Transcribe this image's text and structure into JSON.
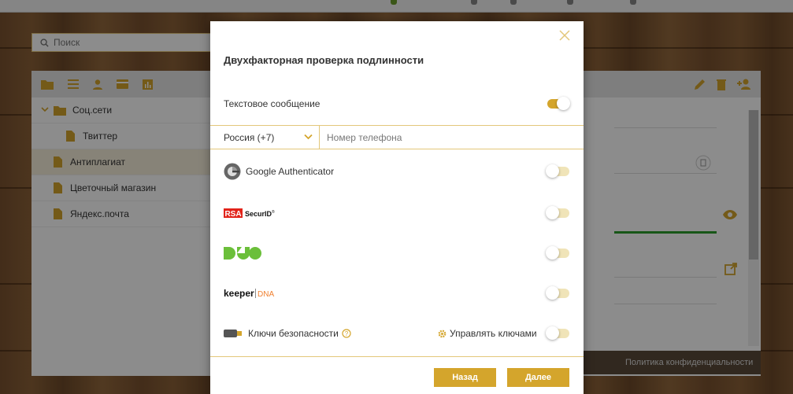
{
  "search": {
    "placeholder": "Поиск"
  },
  "tree": {
    "items": [
      {
        "label": "Соц.сети"
      },
      {
        "label": "Твиттер"
      },
      {
        "label": "Антиплагиат"
      },
      {
        "label": "Цветочный магазин"
      },
      {
        "label": "Яндекс.почта"
      }
    ]
  },
  "footer": {
    "privacy": "Политика конфиденциальности"
  },
  "modal": {
    "title": "Двухфакторная проверка подлинности",
    "sms": {
      "label": "Текстовое сообщение",
      "enabled": true
    },
    "phone": {
      "country": "Россия (+7)",
      "placeholder": "Номер телефона"
    },
    "methods": [
      {
        "label": "Google Authenticator",
        "icon": "google-authenticator-icon",
        "enabled": false
      },
      {
        "label": "RSA SecurID",
        "icon": "rsa-securid-logo",
        "enabled": false
      },
      {
        "label": "DUO",
        "icon": "duo-logo",
        "enabled": false
      },
      {
        "label": "keeper DNA",
        "icon": "keeper-dna-logo",
        "enabled": false
      }
    ],
    "security_keys": {
      "label": "Ключи безопасности",
      "manage_label": "Управлять ключами",
      "enabled": false
    },
    "buttons": {
      "back": "Назад",
      "next": "Далее"
    }
  },
  "colors": {
    "accent": "#d4a52c",
    "toggle_off": "#f0e4b8",
    "green_bar": "#2a9d2a"
  }
}
